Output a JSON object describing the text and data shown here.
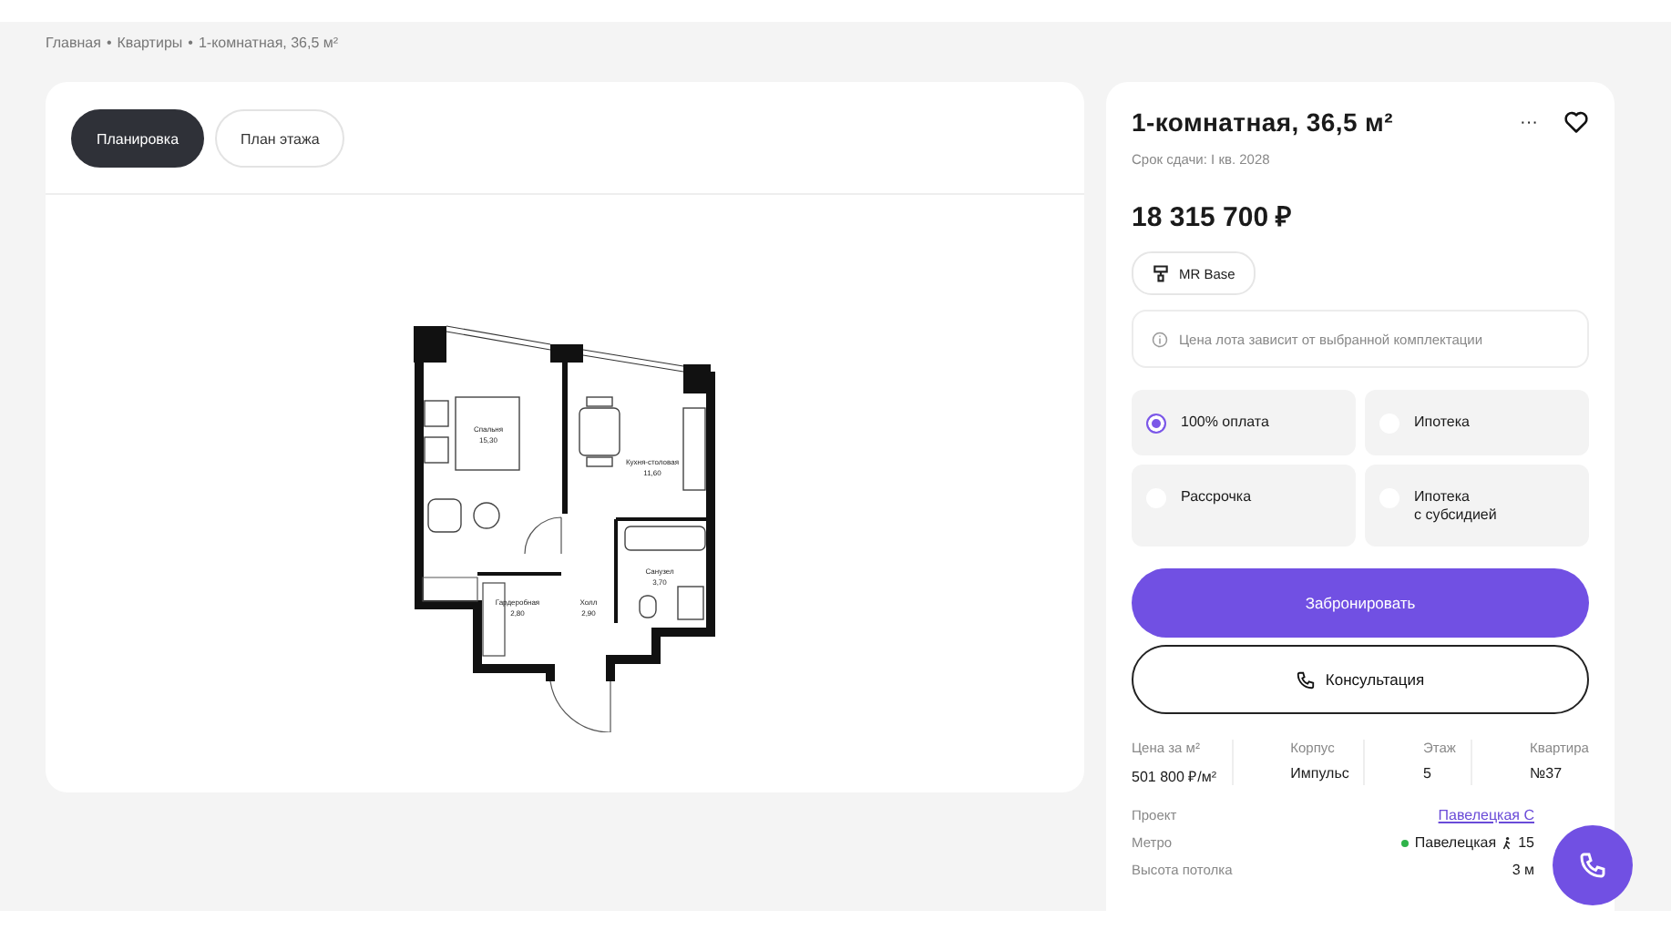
{
  "breadcrumbs": {
    "separator": "•",
    "items": [
      {
        "label": "Главная"
      },
      {
        "label": "Квартиры"
      },
      {
        "label": "1-комнатная, 36,5 м²"
      }
    ]
  },
  "view_tabs": [
    {
      "label": "Планировка",
      "selected": true
    },
    {
      "label": "План этажа",
      "selected": false
    }
  ],
  "floor_plan": {
    "rooms": [
      {
        "name": "Спальня",
        "area": "15,30"
      },
      {
        "name": "Кухня-столовая",
        "area": "11,60"
      },
      {
        "name": "Санузел",
        "area": "3,70"
      },
      {
        "name": "Гардеробная",
        "area": "2,80"
      },
      {
        "name": "Холл",
        "area": "2,90"
      }
    ]
  },
  "listing": {
    "title": "1-комнатная, 36,5 м²",
    "more": "···",
    "favorite": false,
    "delivery": "Срок сдачи: I кв. 2028",
    "price": "18 315 700 ₽",
    "finish": "MR Base",
    "price_note": "Цена лота зависит от выбранной комплектации",
    "payment_options": [
      {
        "label": "100% оплата",
        "selected": true
      },
      {
        "label": "Ипотека",
        "selected": false
      },
      {
        "label": "Рассрочка",
        "selected": false
      },
      {
        "label": "Ипотека\nс субсидией",
        "selected": false
      }
    ],
    "primary_button": "Забронировать",
    "secondary_button": "Консультация",
    "specs": [
      {
        "label": "Цена за м²",
        "value": "501 800 ₽/м²"
      },
      {
        "label": "Корпус",
        "value": "Импульс"
      },
      {
        "label": "Этаж",
        "value": "5"
      },
      {
        "label": "Квартира",
        "value": "№37"
      }
    ],
    "details": [
      {
        "kind": "link",
        "label": "Проект",
        "value": "Павелецкая С"
      },
      {
        "kind": "metro",
        "label": "Метро",
        "value": "Павелецкая",
        "walk": "15",
        "color": "#2fb34a"
      },
      {
        "kind": "text",
        "label": "Высота потолка",
        "value": "3 м"
      }
    ]
  }
}
